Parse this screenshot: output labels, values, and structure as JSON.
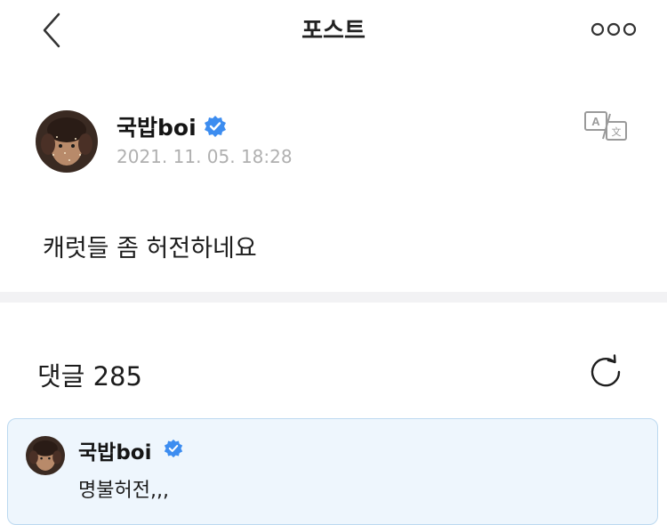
{
  "header": {
    "title": "포스트",
    "back_icon": "chevron-left-icon",
    "more_icon": "more-horizontal-icon"
  },
  "post": {
    "author": "국밥boi",
    "verified_icon": "verified-badge-icon",
    "date": "2021. 11. 05. 18:28",
    "body": "캐럿들 좀 허전하네요",
    "translate_icon": "translate-icon"
  },
  "comments": {
    "title": "댓글 285",
    "refresh_icon": "refresh-icon",
    "items": [
      {
        "author": "국밥boi",
        "text": "명불허전,,,"
      }
    ]
  },
  "colors": {
    "verified": "#3d8df0",
    "date_text": "#b0b0b0",
    "divider": "#f2f2f4",
    "comment_bg": "#eef6fd",
    "comment_border": "#bcd9f0"
  }
}
